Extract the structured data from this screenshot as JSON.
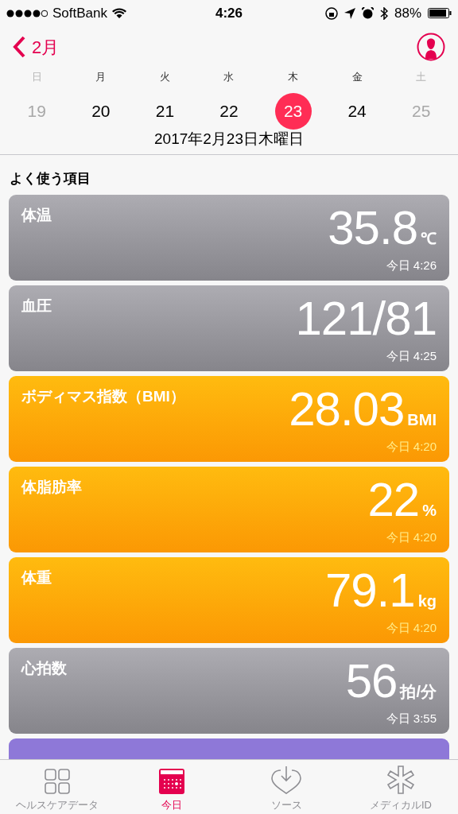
{
  "status_bar": {
    "carrier": "SoftBank",
    "time": "4:26",
    "battery": "88%"
  },
  "nav": {
    "back": "2月"
  },
  "week": [
    {
      "weekday": "日",
      "date": "19",
      "dimmed": true,
      "selected": false
    },
    {
      "weekday": "月",
      "date": "20",
      "dimmed": false,
      "selected": false
    },
    {
      "weekday": "火",
      "date": "21",
      "dimmed": false,
      "selected": false
    },
    {
      "weekday": "水",
      "date": "22",
      "dimmed": false,
      "selected": false
    },
    {
      "weekday": "木",
      "date": "23",
      "dimmed": false,
      "selected": true
    },
    {
      "weekday": "金",
      "date": "24",
      "dimmed": false,
      "selected": false
    },
    {
      "weekday": "土",
      "date": "25",
      "dimmed": true,
      "selected": false
    }
  ],
  "date_title": "2017年2月23日木曜日",
  "section_title": "よく使う項目",
  "cards": [
    {
      "kind": "gray",
      "title": "体温",
      "value": "35.8",
      "unit": "℃",
      "time": "今日 4:26"
    },
    {
      "kind": "gray",
      "title": "血圧",
      "value": "121/81",
      "time": "今日 4:25"
    },
    {
      "kind": "orange",
      "title": "ボディマス指数（BMI）",
      "value": "28.03",
      "unit": "BMI",
      "time": "今日 4:20"
    },
    {
      "kind": "orange",
      "title": "体脂肪率",
      "value": "22",
      "unit": "%",
      "time": "今日 4:20"
    },
    {
      "kind": "orange",
      "title": "体重",
      "value": "79.1",
      "unit": "kg",
      "time": "今日 4:20"
    },
    {
      "kind": "gray",
      "title": "心拍数",
      "value": "56",
      "unit": "拍/分",
      "time": "今日 3:55"
    },
    {
      "kind": "purple"
    }
  ],
  "tabs": [
    {
      "label": "ヘルスケアデータ",
      "selected": false
    },
    {
      "label": "今日",
      "selected": true
    },
    {
      "label": "ソース",
      "selected": false
    },
    {
      "label": "メディカルID",
      "selected": false
    }
  ]
}
